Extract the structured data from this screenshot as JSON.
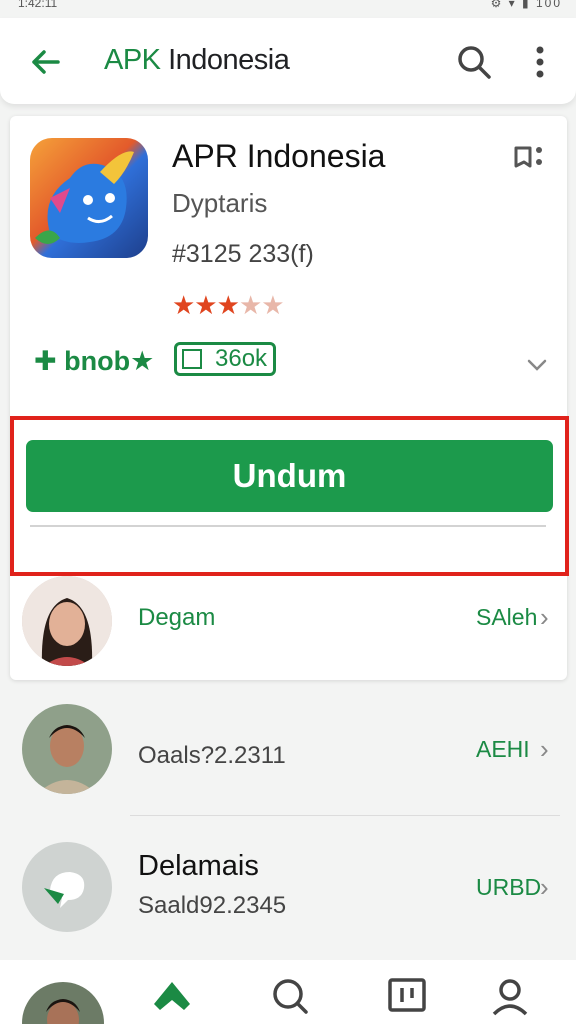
{
  "statusbar": {
    "time": "1:42:11",
    "icons": "⚙ ▾ ▮ 100"
  },
  "appbar": {
    "title_prefix": "APK",
    "title_rest": " Indonesia"
  },
  "app": {
    "name": "APR Indonesia",
    "developer": "Dyptaris",
    "meta": "#3125 233(f)",
    "rating_full": "★★★",
    "rating_empty": "★★",
    "badge_left": "✚ bnob★",
    "badge_box": "36ok",
    "install_label": "Undum"
  },
  "list": [
    {
      "label": "Degam",
      "right": "SAleh"
    },
    {
      "label": "Oaals?2.2311",
      "right": "AEHI"
    },
    {
      "title": "Delamais",
      "label": "Saald92.2345",
      "right": "URBD"
    }
  ],
  "colors": {
    "accent": "#1b8a44",
    "install": "#1c9a4c",
    "highlight": "#e0221b"
  }
}
